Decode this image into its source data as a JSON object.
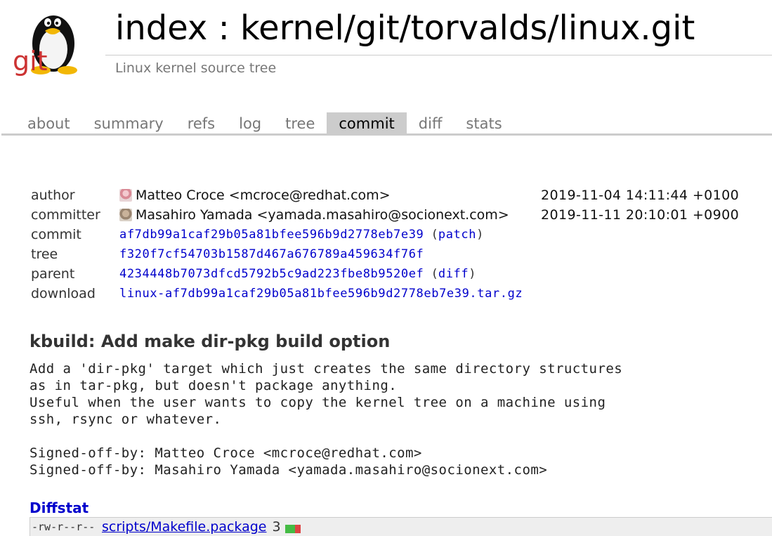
{
  "header": {
    "title": "index : kernel/git/torvalds/linux.git",
    "subtitle": "Linux kernel source tree",
    "logo_text": "git"
  },
  "tabs": [
    {
      "label": "about",
      "active": false
    },
    {
      "label": "summary",
      "active": false
    },
    {
      "label": "refs",
      "active": false
    },
    {
      "label": "log",
      "active": false
    },
    {
      "label": "tree",
      "active": false
    },
    {
      "label": "commit",
      "active": true
    },
    {
      "label": "diff",
      "active": false
    },
    {
      "label": "stats",
      "active": false
    }
  ],
  "commit_info": {
    "author": {
      "label": "author",
      "name": "Matteo Croce <mcroce@redhat.com>",
      "date": "2019-11-04 14:11:44 +0100"
    },
    "committer": {
      "label": "committer",
      "name": "Masahiro Yamada <yamada.masahiro@socionext.com>",
      "date": "2019-11-11 20:10:01 +0900"
    },
    "commit": {
      "label": "commit",
      "hash": "af7db99a1caf29b05a81bfee596b9d2778eb7e39",
      "link": "patch"
    },
    "tree": {
      "label": "tree",
      "hash": "f320f7cf54703b1587d467a676789a459634f76f"
    },
    "parent": {
      "label": "parent",
      "hash": "4234448b7073dfcd5792b5c9ad223fbe8b9520ef",
      "link": "diff"
    },
    "download": {
      "label": "download",
      "file": "linux-af7db99a1caf29b05a81bfee596b9d2778eb7e39.tar.gz"
    }
  },
  "message": {
    "subject": "kbuild: Add make dir-pkg build option",
    "body": "Add a 'dir-pkg' target which just creates the same directory structures\nas in tar-pkg, but doesn't package anything.\nUseful when the user wants to copy the kernel tree on a machine using\nssh, rsync or whatever.\n\nSigned-off-by: Matteo Croce <mcroce@redhat.com>\nSigned-off-by: Masahiro Yamada <yamada.masahiro@socionext.com>"
  },
  "diffstat": {
    "heading": "Diffstat",
    "files": [
      {
        "mode": "-rw-r--r--",
        "file": "scripts/Makefile.package",
        "count": "3"
      }
    ]
  },
  "colors": {
    "link": "#0000cc",
    "active_tab_bg": "#cccccc",
    "add": "#44bb44",
    "remove": "#dd4444"
  }
}
